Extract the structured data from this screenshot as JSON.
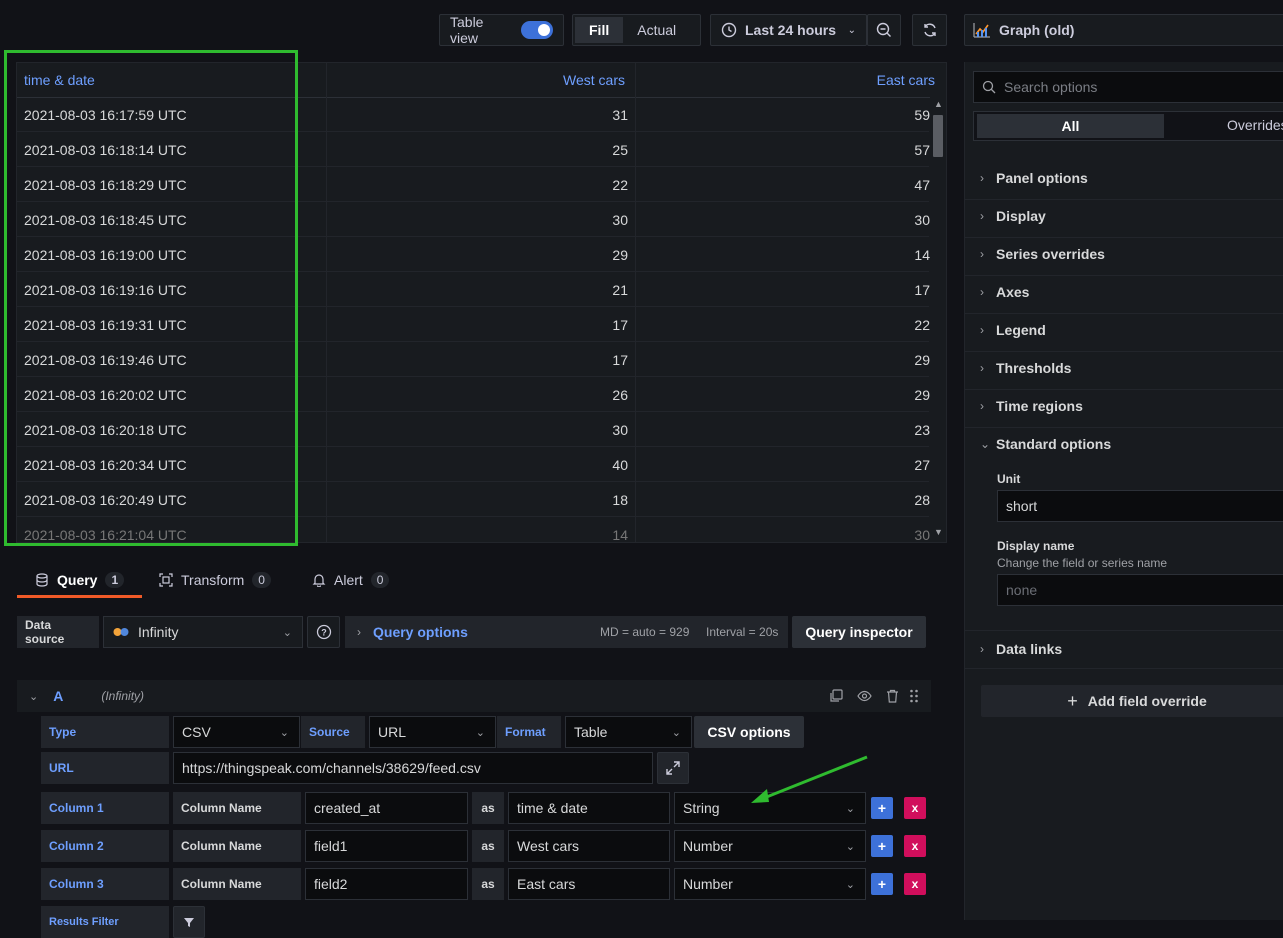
{
  "toolbar": {
    "table_view_label": "Table view",
    "fill_label": "Fill",
    "actual_label": "Actual",
    "time_range": "Last 24 hours",
    "viz_label": "Graph (old)"
  },
  "table": {
    "columns": [
      "time & date",
      "West cars",
      "East cars"
    ],
    "rows": [
      [
        "2021-08-03 16:17:59 UTC",
        "31",
        "59"
      ],
      [
        "2021-08-03 16:18:14 UTC",
        "25",
        "57"
      ],
      [
        "2021-08-03 16:18:29 UTC",
        "22",
        "47"
      ],
      [
        "2021-08-03 16:18:45 UTC",
        "30",
        "30"
      ],
      [
        "2021-08-03 16:19:00 UTC",
        "29",
        "14"
      ],
      [
        "2021-08-03 16:19:16 UTC",
        "21",
        "17"
      ],
      [
        "2021-08-03 16:19:31 UTC",
        "17",
        "22"
      ],
      [
        "2021-08-03 16:19:46 UTC",
        "17",
        "29"
      ],
      [
        "2021-08-03 16:20:02 UTC",
        "26",
        "29"
      ],
      [
        "2021-08-03 16:20:18 UTC",
        "30",
        "23"
      ],
      [
        "2021-08-03 16:20:34 UTC",
        "40",
        "27"
      ],
      [
        "2021-08-03 16:20:49 UTC",
        "18",
        "28"
      ]
    ]
  },
  "tabs": [
    {
      "label": "Query",
      "count": "1"
    },
    {
      "label": "Transform",
      "count": "0"
    },
    {
      "label": "Alert",
      "count": "0"
    }
  ],
  "query_bar": {
    "data_source_label": "Data source",
    "data_source_value": "Infinity",
    "query_options_label": "Query options",
    "md_info": "MD = auto = 929",
    "interval_info": "Interval = 20s",
    "inspector_label": "Query inspector"
  },
  "query_row": {
    "ref_id": "A",
    "ds_name": "(Infinity)"
  },
  "query_form": {
    "type_label": "Type",
    "type_value": "CSV",
    "source_label": "Source",
    "source_value": "URL",
    "format_label": "Format",
    "format_value": "Table",
    "csv_options_label": "CSV options",
    "url_label": "URL",
    "url_value": "https://thingspeak.com/channels/38629/feed.csv",
    "column_name_label": "Column Name",
    "as_label": "as",
    "columns": [
      {
        "label": "Column 1",
        "selector": "created_at",
        "alias": "time & date",
        "type": "String"
      },
      {
        "label": "Column 2",
        "selector": "field1",
        "alias": "West cars",
        "type": "Number"
      },
      {
        "label": "Column 3",
        "selector": "field2",
        "alias": "East cars",
        "type": "Number"
      }
    ],
    "results_filter_label": "Results Filter"
  },
  "options_panel": {
    "search_placeholder": "Search options",
    "tab_all": "All",
    "tab_overrides": "Overrides",
    "sections": [
      "Panel options",
      "Display",
      "Series overrides",
      "Axes",
      "Legend",
      "Thresholds",
      "Time regions"
    ],
    "standard_options": "Standard options",
    "unit_label": "Unit",
    "unit_value": "short",
    "display_name_label": "Display name",
    "display_name_desc": "Change the field or series name",
    "display_name_placeholder": "none",
    "data_links": "Data links",
    "add_override": "Add field override"
  }
}
